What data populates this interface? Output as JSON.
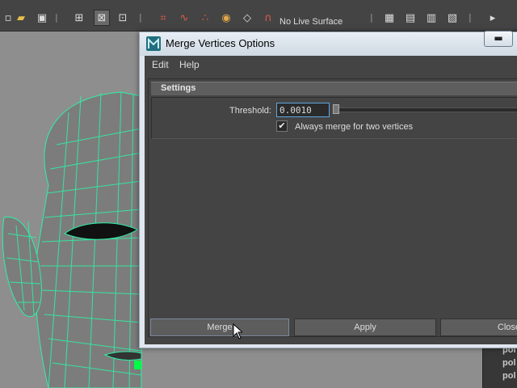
{
  "toolbar": {
    "live_surface_label": "No Live Surface"
  },
  "dialog": {
    "title": "Merge Vertices Options",
    "minimize_symbol": "▬",
    "menu": {
      "edit": "Edit",
      "help": "Help"
    },
    "section_title": "Settings",
    "threshold": {
      "label": "Threshold:",
      "value": "0.0010"
    },
    "checkbox": {
      "checked": true,
      "label": "Always merge for two vertices"
    },
    "buttons": {
      "merge": "Merge",
      "apply": "Apply",
      "close": "Close"
    }
  },
  "outliner": {
    "items": [
      "pol",
      "pol",
      "pol"
    ]
  },
  "colors": {
    "wireframe": "#2ff0a6",
    "selection": "#00ff44",
    "accent": "#5da6e0"
  }
}
